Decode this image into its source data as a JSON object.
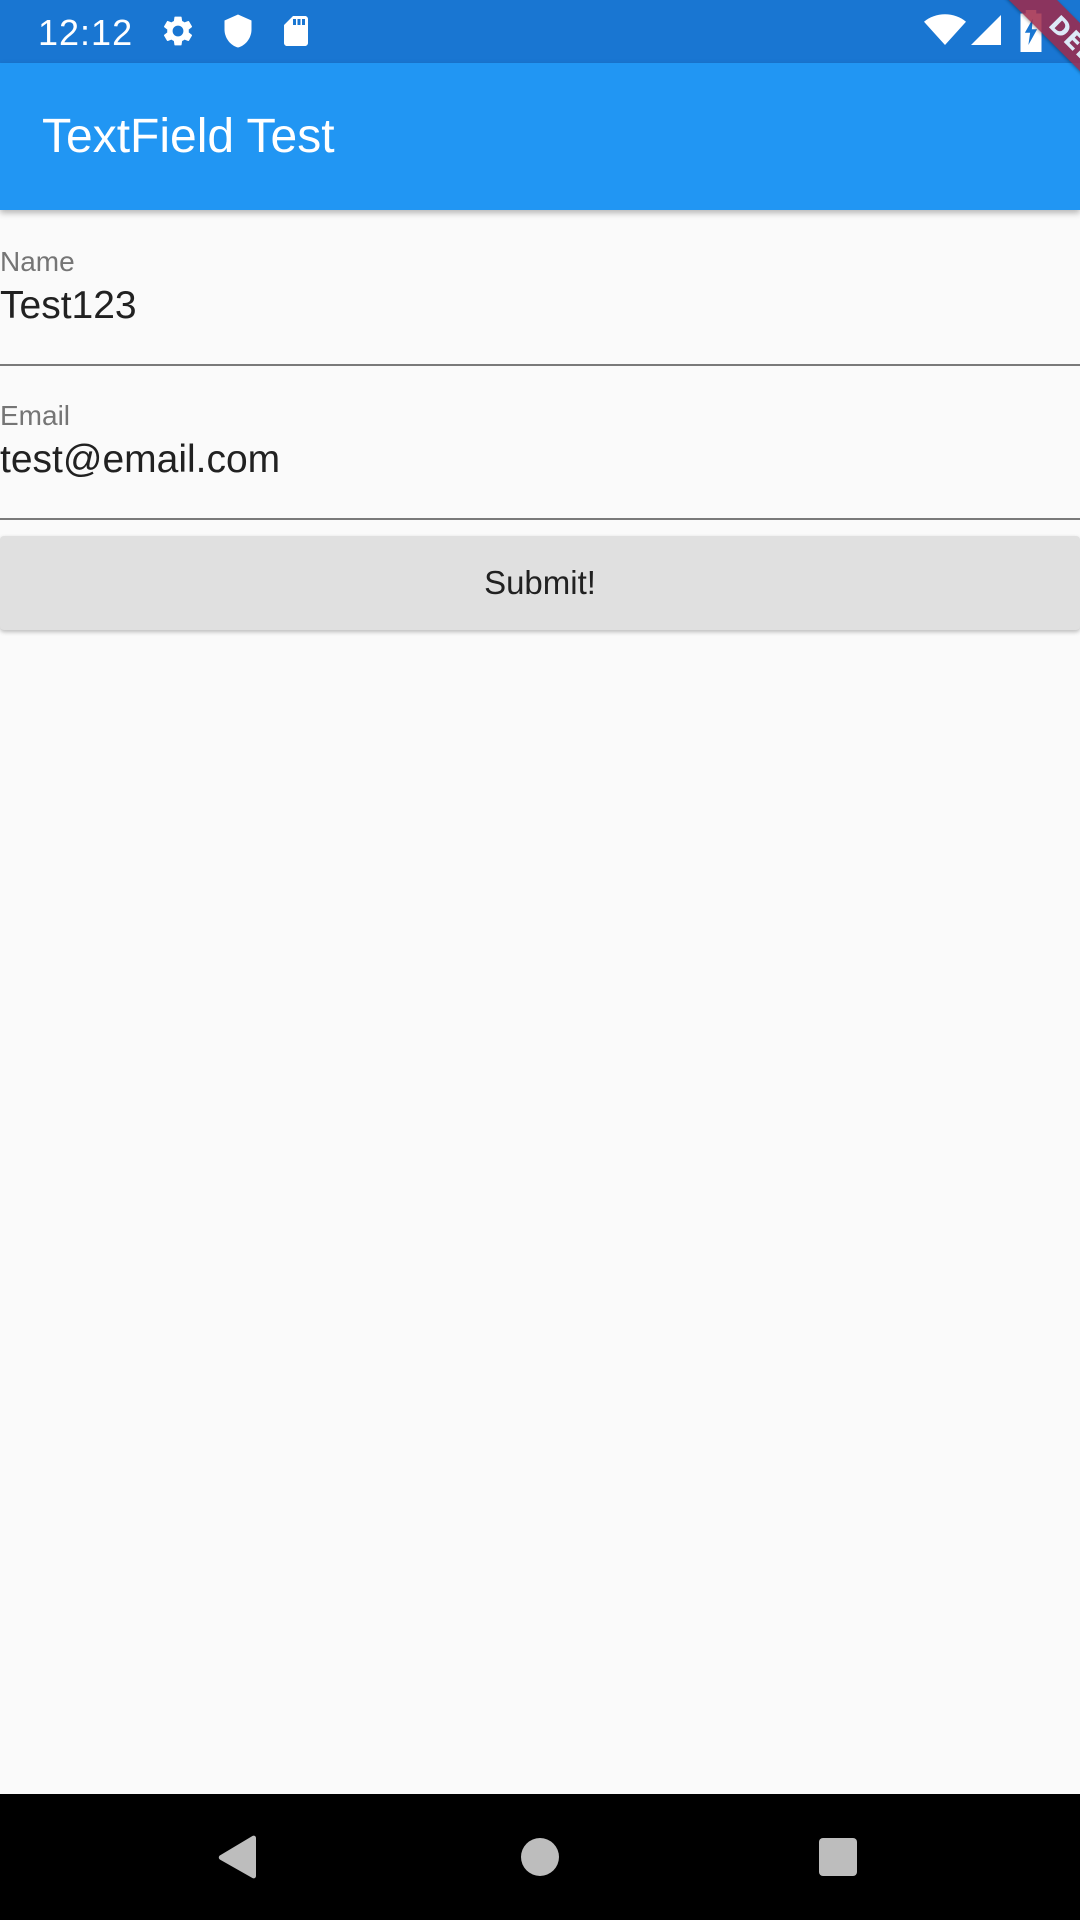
{
  "status_bar": {
    "time": "12:12",
    "icons": [
      "gear-icon",
      "shield-icon",
      "sd-card-icon",
      "wifi-icon",
      "cellular-icon",
      "battery-charging-icon"
    ]
  },
  "app_bar": {
    "title": "TextField Test"
  },
  "debug_banner": {
    "label": "DEBUG"
  },
  "form": {
    "name_field": {
      "label": "Name",
      "value": "Test123"
    },
    "email_field": {
      "label": "Email",
      "value": "test@email.com"
    },
    "submit_label": "Submit!"
  },
  "nav_bar": {
    "icons": [
      "back-icon",
      "home-icon",
      "recents-icon"
    ]
  },
  "colors": {
    "status_bar": "#1976d2",
    "app_bar": "#2196f3",
    "background": "#fafafa",
    "button": "#e0e0e0",
    "debug_banner": "#a0294a"
  }
}
